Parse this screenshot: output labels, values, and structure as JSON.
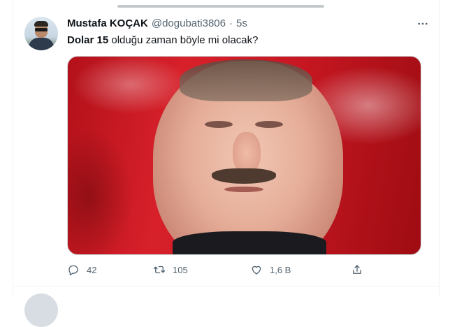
{
  "tweet": {
    "author_name": "Mustafa KOÇAK",
    "handle": "@dogubati3806",
    "separator": "·",
    "time": "5s",
    "text_bold": "Dolar 15",
    "text_rest": " olduğu zaman böyle mi olacak?",
    "media_description_icon": "photo"
  },
  "actions": {
    "reply_count": "42",
    "retweet_count": "105",
    "like_count": "1,6 B"
  },
  "icons": {
    "more": "more-horizontal-icon",
    "reply": "reply-icon",
    "retweet": "retweet-icon",
    "like": "heart-icon",
    "share": "share-icon"
  },
  "colors": {
    "text_primary": "#0f1419",
    "text_secondary": "#536471",
    "border": "#eff3f4"
  }
}
